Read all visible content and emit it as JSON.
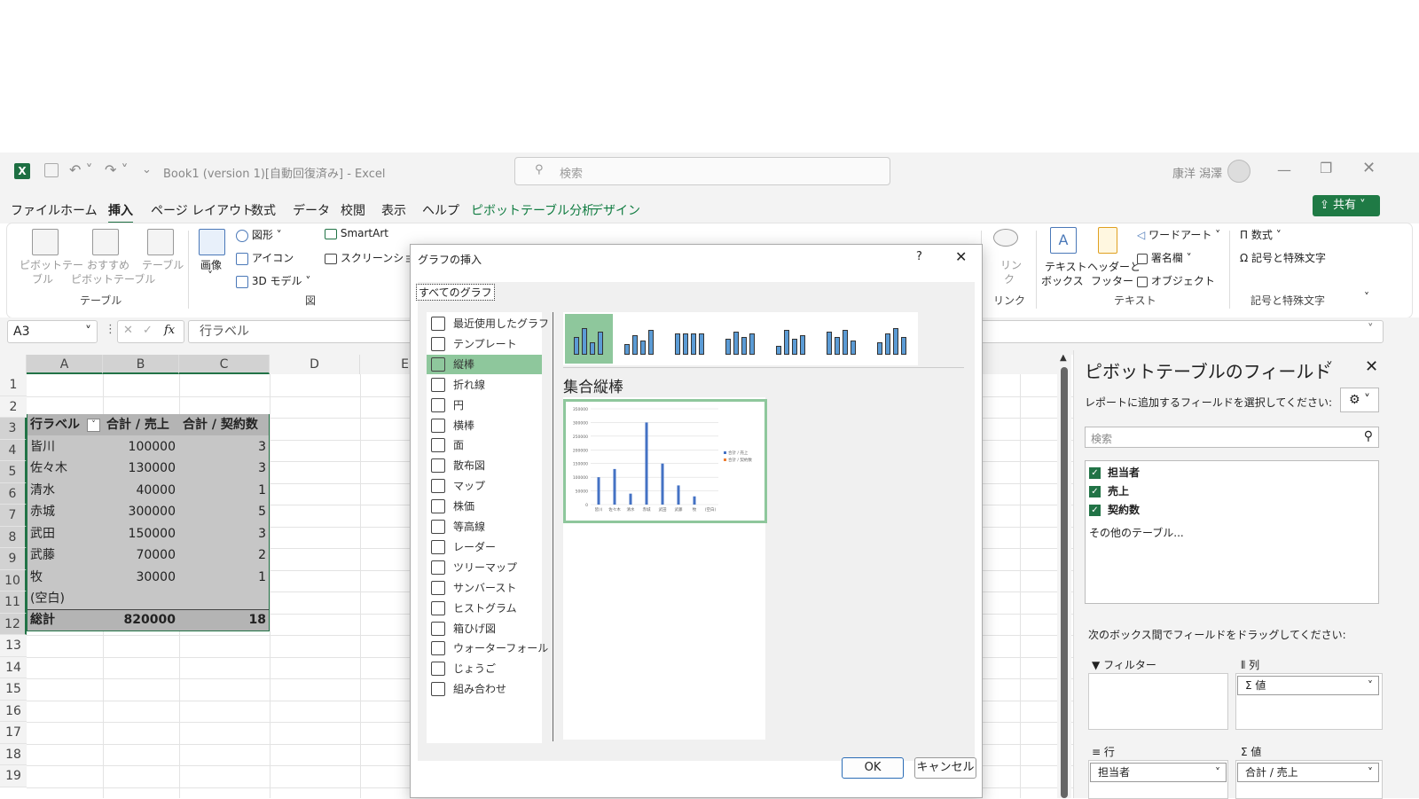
{
  "app": {
    "title": "Book1 (version 1)[自動回復済み]  -  Excel",
    "search_placeholder": "検索",
    "user": "康洋 潟澤",
    "share_label": "共有"
  },
  "menu": {
    "items": [
      "ファイル",
      "ホーム",
      "挿入",
      "ページ レイアウト",
      "数式",
      "データ",
      "校閲",
      "表示",
      "ヘルプ",
      "ピボットテーブル分析",
      "デザイン"
    ]
  },
  "ribbon": {
    "pivot_table": "ピボットテー\nブル",
    "pivot_table_l1": "ピボットテー",
    "pivot_table_l2": "ブル",
    "recommended_l1": "おすすめ",
    "recommended_l2": "ピボットテーブル",
    "table": "テーブル",
    "group_table": "テーブル",
    "image": "画像",
    "shapes": "図形",
    "icons": "アイコン",
    "model3d": "3D モデル",
    "smartart": "SmartArt",
    "screenshot": "スクリーンショット",
    "group_illustrations": "図",
    "link_l1": "リン",
    "link_l2": "ク",
    "group_link": "リンク",
    "textbox_l1": "テキスト",
    "textbox_l2": "ボックス",
    "header_l1": "ヘッダーと",
    "header_l2": "フッター",
    "wordart": "ワードアート",
    "signature": "署名欄",
    "object": "オブジェクト",
    "group_text": "テキスト",
    "equation": "数式",
    "symbol": "記号と特殊文字",
    "group_symbols": "記号と特殊文字"
  },
  "formula_bar": {
    "name_box": "A3",
    "fx": "fx",
    "content": "行ラベル"
  },
  "sheet": {
    "columns": [
      "A",
      "B",
      "C",
      "D",
      "E"
    ],
    "rows": [
      "1",
      "2",
      "3",
      "4",
      "5",
      "6",
      "7",
      "8",
      "9",
      "10",
      "11",
      "12",
      "13",
      "14",
      "15",
      "16",
      "17",
      "18",
      "19"
    ],
    "header": [
      "行ラベル",
      "合計 / 売上",
      "合計 / 契約数"
    ],
    "data": [
      [
        "皆川",
        "100000",
        "3"
      ],
      [
        "佐々木",
        "130000",
        "3"
      ],
      [
        "清水",
        "40000",
        "1"
      ],
      [
        "赤城",
        "300000",
        "5"
      ],
      [
        "武田",
        "150000",
        "3"
      ],
      [
        "武藤",
        "70000",
        "2"
      ],
      [
        "牧",
        "30000",
        "1"
      ],
      [
        "(空白)",
        "",
        ""
      ]
    ],
    "total": [
      "総計",
      "820000",
      "18"
    ]
  },
  "dialog": {
    "title": "グラフの挿入",
    "help": "?",
    "tab": "すべてのグラフ",
    "chart_types": [
      "最近使用したグラフ",
      "テンプレート",
      "縦棒",
      "折れ線",
      "円",
      "横棒",
      "面",
      "散布図",
      "マップ",
      "株価",
      "等高線",
      "レーダー",
      "ツリーマップ",
      "サンバースト",
      "ヒストグラム",
      "箱ひげ図",
      "ウォーターフォール",
      "じょうご",
      "組み合わせ"
    ],
    "selected_type": "縦棒",
    "subtype_title": "集合縦棒",
    "ok": "OK",
    "cancel": "キャンセル"
  },
  "chart_data": {
    "type": "bar",
    "categories": [
      "皆川",
      "佐々木",
      "清水",
      "赤城",
      "武田",
      "武藤",
      "牧",
      "(空白)"
    ],
    "series": [
      {
        "name": "合計 / 売上",
        "values": [
          100000,
          130000,
          40000,
          300000,
          150000,
          70000,
          30000,
          0
        ]
      },
      {
        "name": "合計 / 契約数",
        "values": [
          3,
          3,
          1,
          5,
          3,
          2,
          1,
          0
        ]
      }
    ],
    "ylim": [
      0,
      350000
    ],
    "yticks": [
      "350000",
      "300000",
      "250000",
      "200000",
      "150000",
      "100000",
      "50000",
      "0"
    ],
    "colors": [
      "#4472c4",
      "#ed7d31"
    ],
    "legend": "right"
  },
  "pane": {
    "title": "ピボットテーブルのフィールド",
    "subtitle": "レポートに追加するフィールドを選択してください:",
    "search_placeholder": "検索",
    "fields": [
      "担当者",
      "売上",
      "契約数"
    ],
    "more_tables": "その他のテーブル...",
    "drag_hint": "次のボックス間でフィールドをドラッグしてください:",
    "filter": "フィルター",
    "columns": "列",
    "columns_value": "Σ 値",
    "rows": "行",
    "rows_value": "担当者",
    "values": "値",
    "values_value": "合計 / 売上"
  },
  "colors": {
    "accent": "#217346",
    "selection": "#8ec79c"
  }
}
